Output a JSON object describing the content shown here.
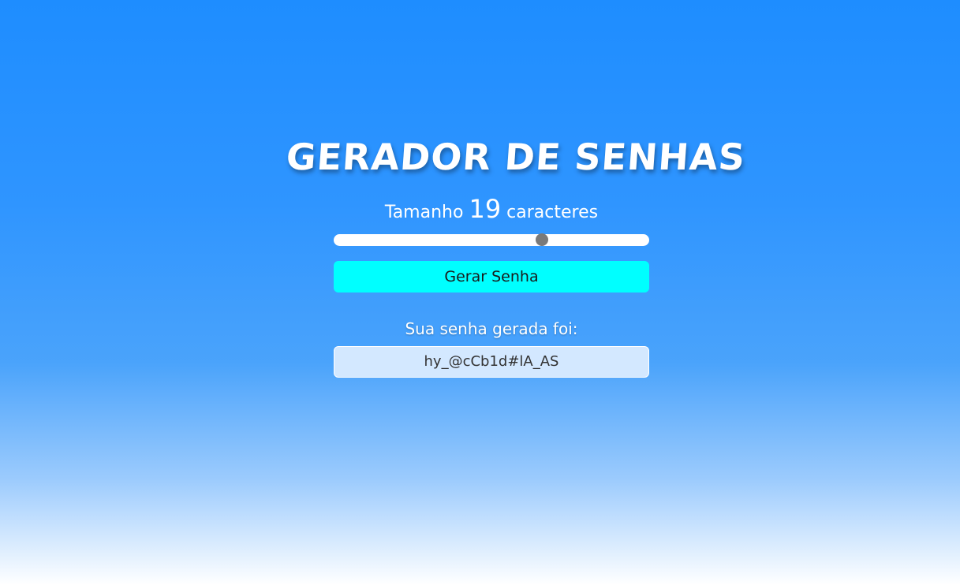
{
  "title": "GERADOR DE SENHAS",
  "size": {
    "prefix": "Tamanho",
    "value": "19",
    "suffix": "caracteres"
  },
  "slider": {
    "value": 19,
    "min": 1,
    "max": 28
  },
  "generate_button": "Gerar Senha",
  "result": {
    "label": "Sua senha gerada foi:",
    "password": "hy_@cCb1d#lA_AS"
  },
  "colors": {
    "button": "#00ffff",
    "slider_thumb": "#7a7a7a",
    "result_box": "#d3e8ff"
  }
}
